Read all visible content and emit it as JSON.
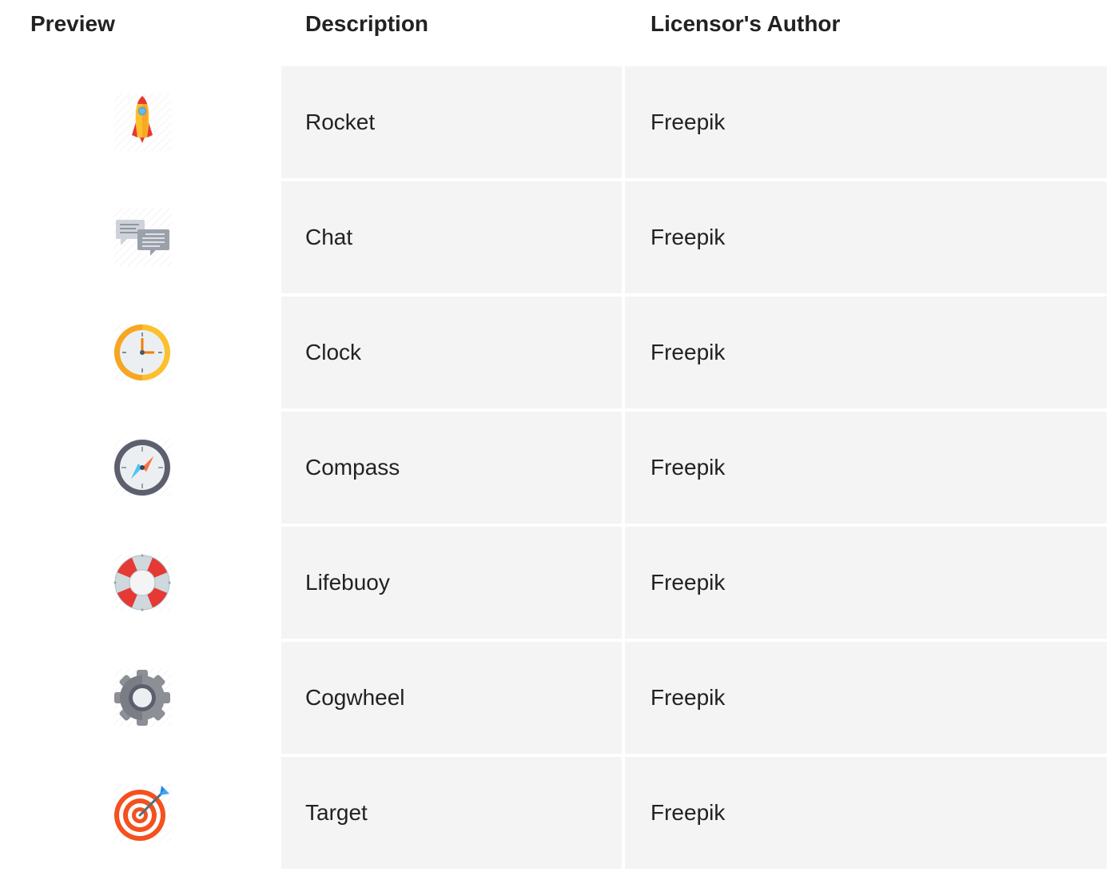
{
  "table": {
    "headers": {
      "preview": "Preview",
      "description": "Description",
      "author": "Licensor's Author"
    },
    "rows": [
      {
        "icon": "rocket-icon",
        "description": "Rocket",
        "author": "Freepik"
      },
      {
        "icon": "chat-icon",
        "description": "Chat",
        "author": "Freepik"
      },
      {
        "icon": "clock-icon",
        "description": "Clock",
        "author": "Freepik"
      },
      {
        "icon": "compass-icon",
        "description": "Compass",
        "author": "Freepik"
      },
      {
        "icon": "lifebuoy-icon",
        "description": "Lifebuoy",
        "author": "Freepik"
      },
      {
        "icon": "cogwheel-icon",
        "description": "Cogwheel",
        "author": "Freepik"
      },
      {
        "icon": "target-icon",
        "description": "Target",
        "author": "Freepik"
      }
    ]
  },
  "colors": {
    "cell_background": "#f4f4f4",
    "text": "#222222"
  }
}
